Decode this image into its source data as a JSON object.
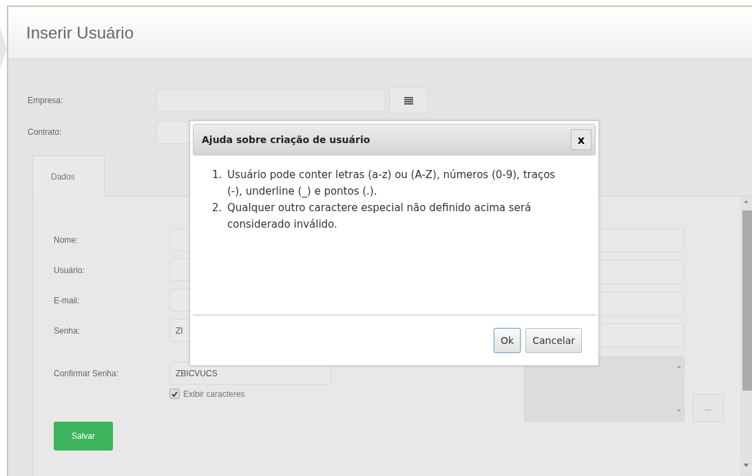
{
  "page": {
    "title": "Inserir Usuário"
  },
  "top_fields": [
    {
      "label": "Empresa:",
      "has_list_button": true
    },
    {
      "label": "Contrato:",
      "has_list_button": false
    }
  ],
  "tabs": [
    {
      "label": "Dados",
      "selected": true
    }
  ],
  "left_fields": [
    {
      "label": "Nome:"
    },
    {
      "label": "Usuário:"
    },
    {
      "label": "E-mail:"
    },
    {
      "label": "Senha:",
      "value": "ZI"
    },
    {
      "label": "Confirmar Senha:",
      "value": "ZBICVUCS"
    }
  ],
  "show_chars": {
    "label": "Exibir caracteres",
    "checked": true
  },
  "save_button": "Salvar",
  "browse_button": "...",
  "dialog": {
    "title": "Ajuda sobre criação de usuário",
    "close": "x",
    "items": [
      {
        "number": "1.",
        "text": "Usuário pode conter letras (a-z) ou (A-Z), números (0-9), traços (-), underline (_) e pontos (.)."
      },
      {
        "number": "2.",
        "text": "Qualquer outro caractere especial não definido acima será considerado inválido."
      }
    ],
    "buttons": [
      {
        "label": "Ok",
        "selected": true
      },
      {
        "label": "Cancelar",
        "selected": false
      }
    ]
  }
}
